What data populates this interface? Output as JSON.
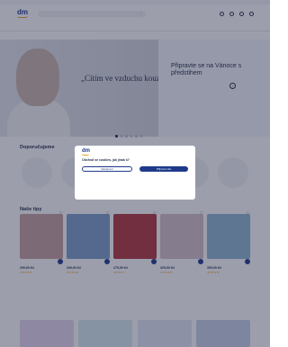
{
  "hero": {
    "left_text": "„Cítím ve vzduchu kouzlo Vánoc“",
    "right_title": "Připravte se na Vánoce s předstihem"
  },
  "sections": {
    "discover_title": "Doporučujeme",
    "products_title": "Naše tipy"
  },
  "products": [
    {
      "price": "299,90 Kč",
      "rating": "★★★★★",
      "color": "#c7a19f"
    },
    {
      "price": "349,90 Kč",
      "rating": "★★★★★",
      "color": "#7c9fc7"
    },
    {
      "price": "279,90 Kč",
      "rating": "★★★★☆",
      "color": "#b2363a"
    },
    {
      "price": "329,90 Kč",
      "rating": "★★★★★",
      "color": "#d6c2c8"
    },
    {
      "price": "399,90 Kč",
      "rating": "★★★★★",
      "color": "#8fb6d0"
    }
  ],
  "cookie": {
    "title": "Obchod se cookies, jak jinak k?",
    "buttons": {
      "settings": "Nastavení",
      "accept": "Přijmout vše"
    }
  }
}
